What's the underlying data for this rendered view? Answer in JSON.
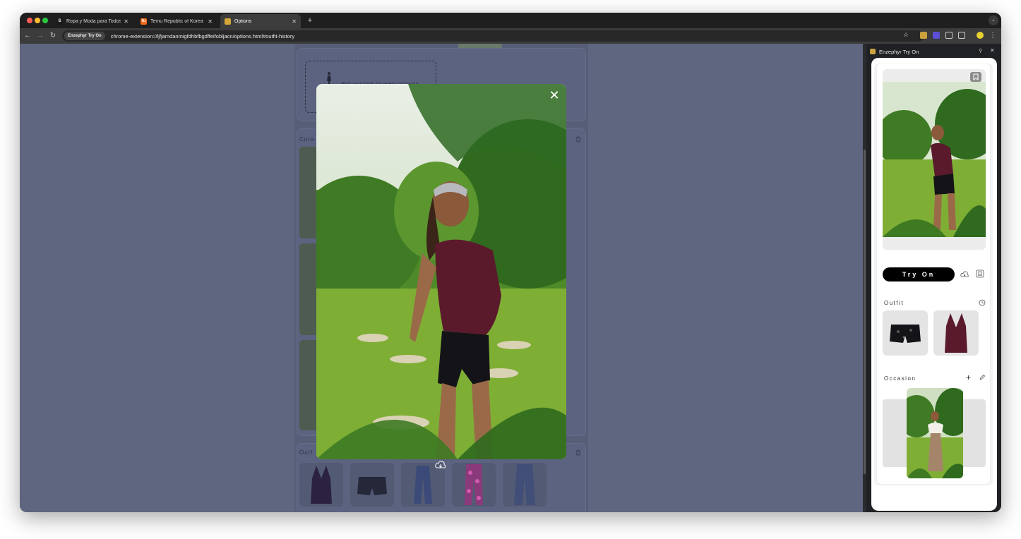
{
  "browser": {
    "tabs": [
      {
        "label": "Ropa y Moda para Todos al M",
        "favicon": "S",
        "favicon_color": "#1a1a1a"
      },
      {
        "label": "Temu Republic of Korea | Exp",
        "favicon": "tu",
        "favicon_color": "#f26b1d"
      },
      {
        "label": "Options",
        "favicon": "",
        "favicon_color": "#d4a63a"
      }
    ],
    "extension_chip": "Enzephyr Try On",
    "url": "chrome-extension://ljfjamdanmigfdhbfbgdffeifobljacn/options.html#outfit-history"
  },
  "page": {
    "pick_prompt": "Pick your look for every occasion",
    "curated_label": "Cura",
    "outfit_label": "Outf"
  },
  "side_panel": {
    "title": "Enzephyr Try On",
    "try_on_label": "Try On",
    "outfit_label": "Outfit",
    "occasion_label": "Occasion"
  },
  "colors": {
    "overlay": "#5f6680",
    "try_on_bg": "#000000",
    "top_garment": "#5a1a2c"
  },
  "icons": [
    "close-icon",
    "cloud-download-icon",
    "bookmark-icon",
    "history-clock-icon",
    "plus-icon",
    "pencil-icon",
    "trash-icon",
    "pin-icon",
    "star-icon"
  ]
}
